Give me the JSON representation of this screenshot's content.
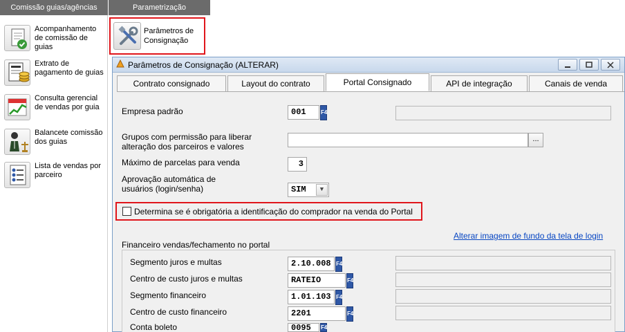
{
  "nav": {
    "left_header": "Comissão guias/agências",
    "param_header": "Parametrização",
    "items": [
      {
        "label": "Acompanhamento de comissão de guias",
        "icon": "report-check-icon"
      },
      {
        "label": "Extrato de pagamento de guias",
        "icon": "statement-coins-icon"
      },
      {
        "label": "Consulta gerencial de vendas por guia",
        "icon": "calendar-chart-icon"
      },
      {
        "label": "Balancete comissão dos guias",
        "icon": "person-scale-icon"
      },
      {
        "label": "Lista de vendas por parceiro",
        "icon": "list-icon"
      }
    ],
    "param_item": {
      "label": "Parâmetros de Consignação",
      "icon": "tools-icon"
    }
  },
  "dialog": {
    "title": "Parâmetros de Consignação (ALTERAR)",
    "tabs": [
      "Contrato consignado",
      "Layout do contrato",
      "Portal Consignado",
      "API de integração",
      "Canais de venda"
    ],
    "active_tab": "Portal Consignado"
  },
  "form": {
    "empresa_label": "Empresa padrão",
    "empresa_value": "001",
    "grupos_label_1": "Grupos com permissão para liberar",
    "grupos_label_2": "alteração dos parceiros e valores",
    "grupos_value": "",
    "dots_label": "...",
    "max_parcelas_label": "Máximo de parcelas para venda",
    "max_parcelas_value": "3",
    "aprovacao_label_1": "Aprovação automática de",
    "aprovacao_label_2": "usuários (login/senha)",
    "aprovacao_value": "SIM",
    "checkbox_label": "Determina se é obrigatória a identificação do comprador na venda do Portal",
    "checkbox_checked": false,
    "link_label": "Alterar imagem de fundo da tela de login",
    "financeiro_title": "Financeiro vendas/fechamento no portal",
    "rows": [
      {
        "label": "Segmento juros e multas",
        "value": "2.10.008"
      },
      {
        "label": "Centro de custo juros e multas",
        "value": "RATEIO"
      },
      {
        "label": "Segmento financeiro",
        "value": "1.01.103"
      },
      {
        "label": "Centro de custo financeiro",
        "value": "2201"
      },
      {
        "label": "Conta boleto",
        "value": "0095"
      }
    ],
    "f4_label": "F4"
  },
  "colors": {
    "highlight": "#e0151b",
    "f4_button": "#2f58a6",
    "link": "#0645c2",
    "header": "#6b6b6b"
  }
}
